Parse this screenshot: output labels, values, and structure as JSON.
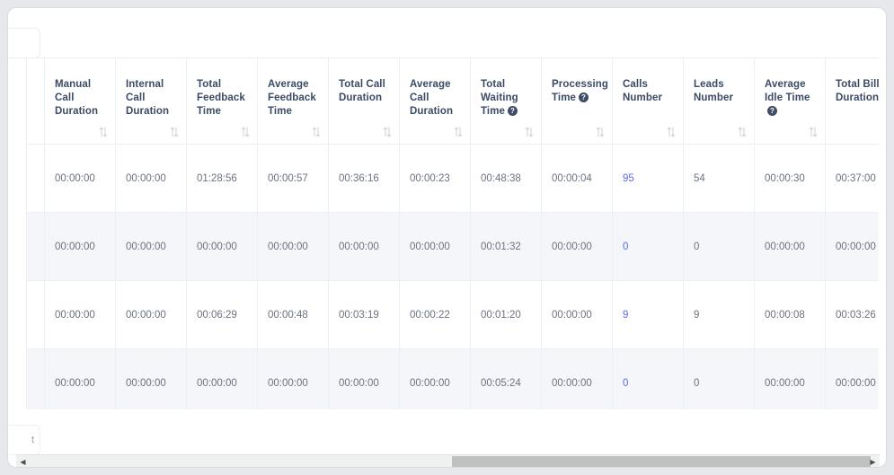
{
  "window": {
    "background_color": "#e6e8ec",
    "card_color": "#ffffff"
  },
  "ghost_top": {
    "label": ""
  },
  "ghost_bottom": {
    "label": "t"
  },
  "table": {
    "sort_icon": "sort-updown-icon",
    "help_icon": "help-question-icon",
    "columns": [
      {
        "label": "Manual Call Duration",
        "help": false,
        "sortable": true
      },
      {
        "label": "Internal Call Duration",
        "help": false,
        "sortable": true
      },
      {
        "label": "Total Feedback Time",
        "help": false,
        "sortable": true
      },
      {
        "label": "Average Feedback Time",
        "help": false,
        "sortable": true
      },
      {
        "label": "Total Call Duration",
        "help": false,
        "sortable": true
      },
      {
        "label": "Average Call Duration",
        "help": false,
        "sortable": true
      },
      {
        "label": "Total Waiting Time",
        "help": true,
        "sortable": true
      },
      {
        "label": "Processing Time",
        "help": true,
        "sortable": true
      },
      {
        "label": "Calls Number",
        "help": false,
        "sortable": true
      },
      {
        "label": "Leads Number",
        "help": false,
        "sortable": true
      },
      {
        "label": "Average Idle Time",
        "help": true,
        "sortable": true
      },
      {
        "label": "Total Bill Duration",
        "help": false,
        "sortable": true
      }
    ],
    "rows": [
      {
        "alt": false,
        "cells": [
          {
            "value": "00:00:00",
            "link": false
          },
          {
            "value": "00:00:00",
            "link": false
          },
          {
            "value": "01:28:56",
            "link": false
          },
          {
            "value": "00:00:57",
            "link": false
          },
          {
            "value": "00:36:16",
            "link": false
          },
          {
            "value": "00:00:23",
            "link": false
          },
          {
            "value": "00:48:38",
            "link": false
          },
          {
            "value": "00:00:04",
            "link": false
          },
          {
            "value": "95",
            "link": true
          },
          {
            "value": "54",
            "link": false
          },
          {
            "value": "00:00:30",
            "link": false
          },
          {
            "value": "00:37:00",
            "link": false
          }
        ]
      },
      {
        "alt": true,
        "cells": [
          {
            "value": "00:00:00",
            "link": false
          },
          {
            "value": "00:00:00",
            "link": false
          },
          {
            "value": "00:00:00",
            "link": false
          },
          {
            "value": "00:00:00",
            "link": false
          },
          {
            "value": "00:00:00",
            "link": false
          },
          {
            "value": "00:00:00",
            "link": false
          },
          {
            "value": "00:01:32",
            "link": false
          },
          {
            "value": "00:00:00",
            "link": false
          },
          {
            "value": "0",
            "link": true
          },
          {
            "value": "0",
            "link": false
          },
          {
            "value": "00:00:00",
            "link": false
          },
          {
            "value": "00:00:00",
            "link": false
          }
        ]
      },
      {
        "alt": false,
        "cells": [
          {
            "value": "00:00:00",
            "link": false
          },
          {
            "value": "00:00:00",
            "link": false
          },
          {
            "value": "00:06:29",
            "link": false
          },
          {
            "value": "00:00:48",
            "link": false
          },
          {
            "value": "00:03:19",
            "link": false
          },
          {
            "value": "00:00:22",
            "link": false
          },
          {
            "value": "00:01:20",
            "link": false
          },
          {
            "value": "00:00:00",
            "link": false
          },
          {
            "value": "9",
            "link": true
          },
          {
            "value": "9",
            "link": false
          },
          {
            "value": "00:00:08",
            "link": false
          },
          {
            "value": "00:03:26",
            "link": false
          }
        ]
      },
      {
        "alt": true,
        "cells": [
          {
            "value": "00:00:00",
            "link": false
          },
          {
            "value": "00:00:00",
            "link": false
          },
          {
            "value": "00:00:00",
            "link": false
          },
          {
            "value": "00:00:00",
            "link": false
          },
          {
            "value": "00:00:00",
            "link": false
          },
          {
            "value": "00:00:00",
            "link": false
          },
          {
            "value": "00:05:24",
            "link": false
          },
          {
            "value": "00:00:00",
            "link": false
          },
          {
            "value": "0",
            "link": true
          },
          {
            "value": "0",
            "link": false
          },
          {
            "value": "00:00:00",
            "link": false
          },
          {
            "value": "00:00:00",
            "link": false
          }
        ]
      }
    ]
  },
  "scrollbar": {
    "orientation": "horizontal",
    "left_arrow": "◀",
    "right_arrow": "▶",
    "thumb_position_percent": 66
  },
  "colors": {
    "header_text": "#3b4a66",
    "cell_text": "#6b7280",
    "link": "#5b6cf0",
    "alt_row_bg": "#f4f6fa",
    "grid_border": "#eaf1f6",
    "help_badge_bg": "#3f4d66"
  }
}
